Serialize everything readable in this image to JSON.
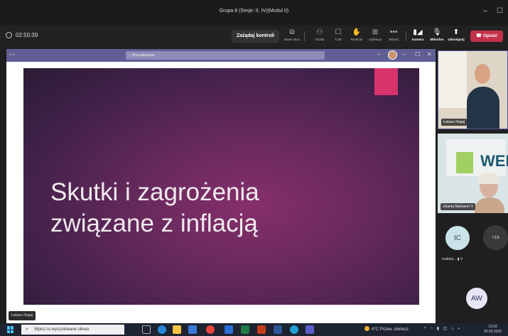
{
  "window": {
    "title": "Grupa 8 (Sesje: II, IV)(Modul II)"
  },
  "toolbar": {
    "timer": "02:50:39",
    "control_button": "Zażądaj kontroli",
    "tools": [
      {
        "icon": "new-window-icon",
        "label": "Nowe okno"
      },
      {
        "icon": "people-icon",
        "label": "Osoby"
      },
      {
        "icon": "chat-icon",
        "label": "Czat"
      },
      {
        "icon": "reactions-icon",
        "label": "Reakcje"
      },
      {
        "icon": "apps-icon",
        "label": "Aplikacje"
      },
      {
        "icon": "more-icon",
        "label": "Więcej"
      },
      {
        "icon": "camera-off-icon",
        "label": "Kamera"
      },
      {
        "icon": "mic-off-icon",
        "label": "Mikrofon"
      },
      {
        "icon": "share-icon",
        "label": "Udostępnij"
      }
    ],
    "leave_button": "Opuść"
  },
  "shared_screen": {
    "search_placeholder": "Wyszukiwanie",
    "slide_title_line1": "Skutki i zagrożenia",
    "slide_title_line2": "związane z inflacją",
    "presenter_badge": "Łukasz Nogaj"
  },
  "participants": {
    "tile1_name": "Łukasz Nogaj",
    "tile2_name": "Jolanta Markwort",
    "tile2_logo_text": "WEF",
    "ic_initials": "IC",
    "ic_name": "Izabela...",
    "more_count": "+18",
    "aw_initials": "AW"
  },
  "taskbar": {
    "search_placeholder": "Wpisz tu wyszukiwane słowa",
    "weather": "4°C  Przew. słonecz.",
    "time": "13:16",
    "date": "26.02.2022"
  },
  "colors": {
    "teams_purple": "#5f5f96",
    "leave_red": "#c4314b",
    "slide_accent": "#d8336d",
    "slide_bg": "#6a2a5e"
  }
}
